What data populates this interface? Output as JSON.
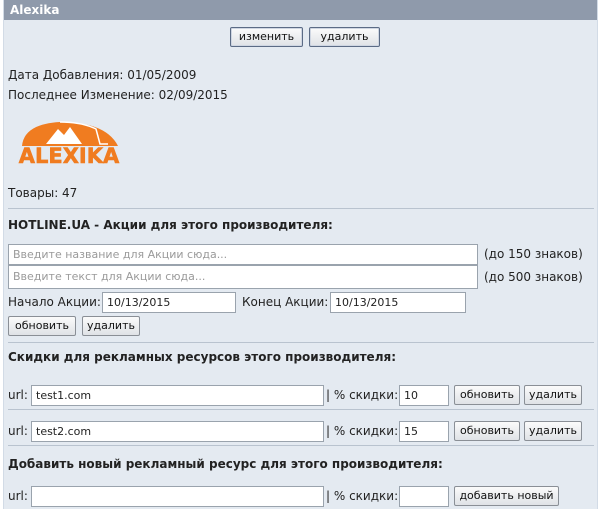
{
  "window": {
    "title": "Alexika"
  },
  "toolbar": {
    "edit_label": "изменить",
    "delete_label": "удалить"
  },
  "info": {
    "date_added": "Дата Добавления: 01/05/2009",
    "last_modified": "Последнее Изменение: 02/09/2015",
    "logo_text": "ALEXIKA",
    "products": "Товары: 47"
  },
  "promo": {
    "heading": "HOTLINE.UA - Акции для этого производителя:",
    "name_placeholder": "Введите название для Акции сюда...",
    "name_limit": "(до 150 знаков)",
    "text_placeholder": "Введите текст для Акции сюда...",
    "text_limit": "(до 500 знаков)",
    "start_label": "Начало Акции:",
    "start_value": "10/13/2015",
    "end_label": "Конец Акции:",
    "end_value": "10/13/2015",
    "update_label": "обновить",
    "delete_label": "удалить"
  },
  "discounts": {
    "heading": "Скидки для рекламных ресурсов этого производителя:",
    "url_label": "url:",
    "discount_label": "| % скидки:",
    "rows": [
      {
        "url": "test1.com",
        "discount": "10",
        "update_label": "обновить",
        "delete_label": "удалить"
      },
      {
        "url": "test2.com",
        "discount": "15",
        "update_label": "обновить",
        "delete_label": "удалить"
      }
    ]
  },
  "new_resource": {
    "heading": "Добавить новый рекламный ресурс для этого производителя:",
    "url_label": "url:",
    "url_value": "",
    "discount_label": "| % скидки:",
    "discount_value": "",
    "add_label": "добавить новый"
  },
  "colors": {
    "title_bar": "#8f9aab",
    "panel": "#e4eaf1",
    "logo_orange": "#f07c20"
  }
}
